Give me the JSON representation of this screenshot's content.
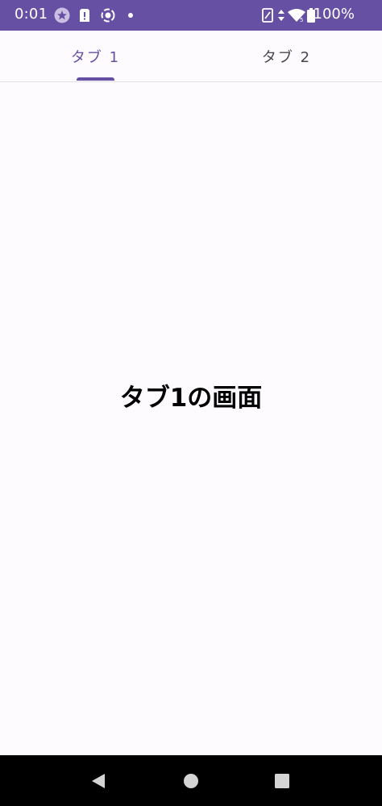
{
  "status_bar": {
    "time": "0:01",
    "battery_percent": "100%",
    "background_color": "#6650a4",
    "left_icons": [
      "star-notification-icon",
      "sim-alert-icon",
      "screen-record-icon",
      "dot-icon"
    ],
    "right_icons": [
      "nfc-icon",
      "data-arrows-icon",
      "wifi-icon",
      "battery-icon"
    ]
  },
  "tabs": [
    {
      "label": "タブ 1",
      "selected": true
    },
    {
      "label": "タブ 2",
      "selected": false
    }
  ],
  "content": {
    "screen_text": "タブ1の画面"
  },
  "nav_bar": {
    "buttons": [
      "back-icon",
      "home-icon",
      "recents-icon"
    ]
  },
  "colors": {
    "accent": "#6650a4",
    "background": "#fefbfe",
    "tab_unselected": "#49454f"
  }
}
